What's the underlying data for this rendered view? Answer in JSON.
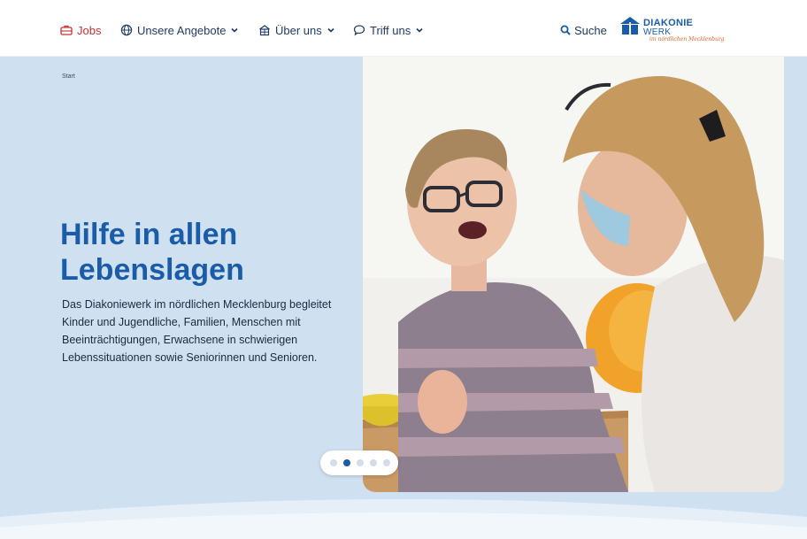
{
  "nav": {
    "items": [
      {
        "label": "Jobs"
      },
      {
        "label": "Unsere Angebote"
      },
      {
        "label": "Über uns"
      },
      {
        "label": "Triff uns"
      }
    ],
    "search_label": "Suche"
  },
  "logo": {
    "line1": "DIAKONIE",
    "line2": "WERK",
    "tagline": "im nördlichen Mecklenburg"
  },
  "hero": {
    "breadcrumb": "Start",
    "headline_line1": "Hilfe in allen",
    "headline_line2": "Lebenslagen",
    "intro": "Das Diakoniewerk im nördlichen Mecklenburg begleitet Kinder und Jugendliche, Familien, Menschen mit Beeinträchtigungen, Erwachsene in schwierigen Lebenssituationen sowie Seniorinnen und Senioren."
  },
  "slider": {
    "slide_count": 5,
    "active_index": 1
  },
  "colors": {
    "brand_blue": "#1a5ca8",
    "hero_bg": "#cfe0f1",
    "jobs_red": "#c8312f",
    "logo_orange": "#e0642a"
  },
  "icons": {
    "jobs": "briefcase-icon",
    "angebote": "globe-icon",
    "ueber_uns": "building-icon",
    "triff_uns": "chat-bubble-icon",
    "search": "search-icon",
    "chevron": "chevron-down-icon"
  }
}
